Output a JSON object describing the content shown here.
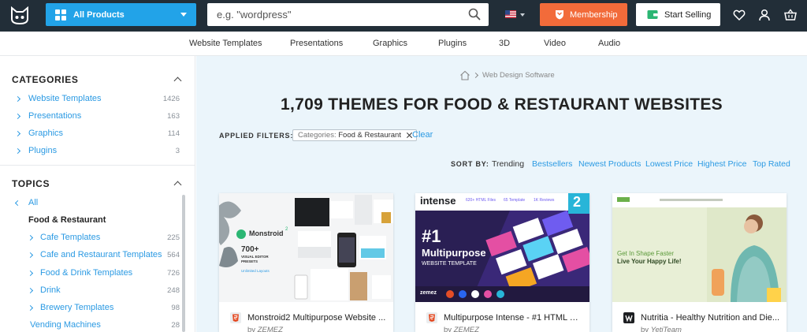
{
  "header": {
    "logo_icon": "cat-logo-icon",
    "all_products_label": "All Products",
    "search_placeholder": "e.g. \"wordpress\"",
    "search_value": "",
    "membership_label": "Membership",
    "start_selling_label": "Start Selling",
    "colors": {
      "bar": "#222e38",
      "all_products": "#22a3e8",
      "membership": "#f26b3a"
    }
  },
  "subnav": {
    "items": [
      "Website Templates",
      "Presentations",
      "Graphics",
      "Plugins",
      "3D",
      "Video",
      "Audio"
    ]
  },
  "sidebar": {
    "categories": {
      "title": "CATEGORIES",
      "items": [
        {
          "label": "Website Templates",
          "count": "1426"
        },
        {
          "label": "Presentations",
          "count": "163"
        },
        {
          "label": "Graphics",
          "count": "114"
        },
        {
          "label": "Plugins",
          "count": "3"
        }
      ]
    },
    "topics": {
      "title": "TOPICS",
      "all_label": "All",
      "current_label": "Food & Restaurant",
      "items": [
        {
          "label": "Cafe Templates",
          "count": "225"
        },
        {
          "label": "Cafe and Restaurant Templates",
          "count": "564"
        },
        {
          "label": "Food & Drink Templates",
          "count": "726"
        },
        {
          "label": "Drink",
          "count": "248"
        },
        {
          "label": "Brewery Templates",
          "count": "98"
        }
      ],
      "extra_item": {
        "label": "Vending Machines",
        "count": "28"
      }
    }
  },
  "main": {
    "breadcrumb": "Web Design Software",
    "heading": "1,709 THEMES FOR FOOD & RESTAURANT WEBSITES",
    "applied_filters_label": "APPLIED FILTERS:",
    "filter_chip": {
      "key": "Categories:",
      "value": "Food & Restaurant"
    },
    "clear_label": "Clear",
    "sort_by_label": "SORT BY:",
    "sort_options": [
      "Trending",
      "Bestsellers",
      "Newest Products",
      "Lowest Price",
      "Highest Price",
      "Top Rated"
    ]
  },
  "cards": [
    {
      "title": "Monstroid2 Multipurpose Website ...",
      "author_prefix": "by",
      "author": "ZEMEZ",
      "format_icon": "html5-icon",
      "thumb_texts": {
        "brand": "Monstroid",
        "sup": "2",
        "big": "700+",
        "small": "VISUAL EDITOR PRESETS",
        "link": "Unlimited Layouts"
      }
    },
    {
      "title": "Multipurpose Intense - #1 HTML Bo...",
      "author_prefix": "by",
      "author": "ZEMEZ",
      "format_icon": "html5-icon",
      "thumb_texts": {
        "brand": "intense",
        "stat1": "620+ HTML Files",
        "stat2": "65 Template",
        "stat3": "1K Reviews",
        "badge": "2",
        "big": "#1",
        "headline": "Multipurpose",
        "sub": "WEBSITE TEMPLATE",
        "vendor": "zemez"
      }
    },
    {
      "title": "Nutritia - Healthy Nutrition and Die...",
      "author_prefix": "by",
      "author": "YetiTeam",
      "format_icon": "wordpress-icon",
      "thumb_texts": {
        "line1": "Get In Shape Faster",
        "line2": "Live Your Happy Life!"
      }
    }
  ]
}
